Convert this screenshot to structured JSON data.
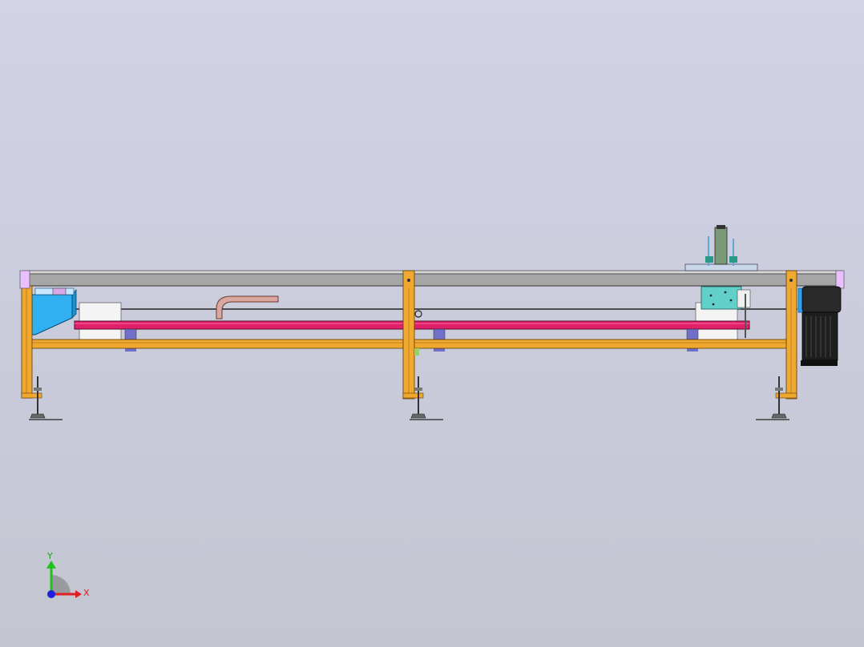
{
  "viewport": {
    "background_top": "#d2d3e6",
    "background_bottom": "#c3c5d0"
  },
  "model": {
    "frame_color": "#f0a830",
    "belt_color": "#e0206a",
    "rail_color": "#a8a8a8",
    "hopper_color": "#30b0f0",
    "motor_color": "#1e1e1e",
    "pad_color": "#7070c8"
  },
  "triad": {
    "x_label": "X",
    "y_label": "Y",
    "x_color": "#e02020",
    "y_color": "#20c020",
    "z_color": "#2020e0"
  }
}
